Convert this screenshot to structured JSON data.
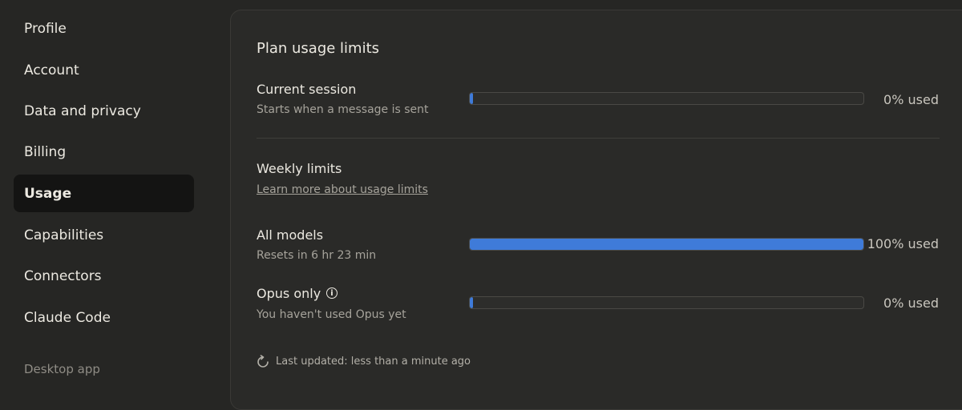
{
  "sidebar": {
    "items": [
      {
        "label": "Profile"
      },
      {
        "label": "Account"
      },
      {
        "label": "Data and privacy"
      },
      {
        "label": "Billing"
      },
      {
        "label": "Usage",
        "active": true
      },
      {
        "label": "Capabilities"
      },
      {
        "label": "Connectors"
      },
      {
        "label": "Claude Code"
      }
    ],
    "footer": "Desktop app"
  },
  "main": {
    "title": "Plan usage limits",
    "current_session": {
      "label": "Current session",
      "sub": "Starts when a message is sent",
      "percent_used": 0,
      "used_label": "0% used"
    },
    "weekly": {
      "title": "Weekly limits",
      "link": "Learn more about usage limits"
    },
    "all_models": {
      "label": "All models",
      "sub": "Resets in 6 hr 23 min",
      "percent_used": 100,
      "used_label": "100% used"
    },
    "opus": {
      "label": "Opus only",
      "sub": "You haven't used Opus yet",
      "percent_used": 0,
      "used_label": "0% used"
    },
    "last_updated": "Last updated: less than a minute ago"
  },
  "icons": {
    "info": "info-icon",
    "refresh": "refresh-icon"
  },
  "colors": {
    "accent": "#3f7bd9",
    "background": "#262624",
    "panel": "#2a2a28",
    "active_nav": "#141413"
  }
}
